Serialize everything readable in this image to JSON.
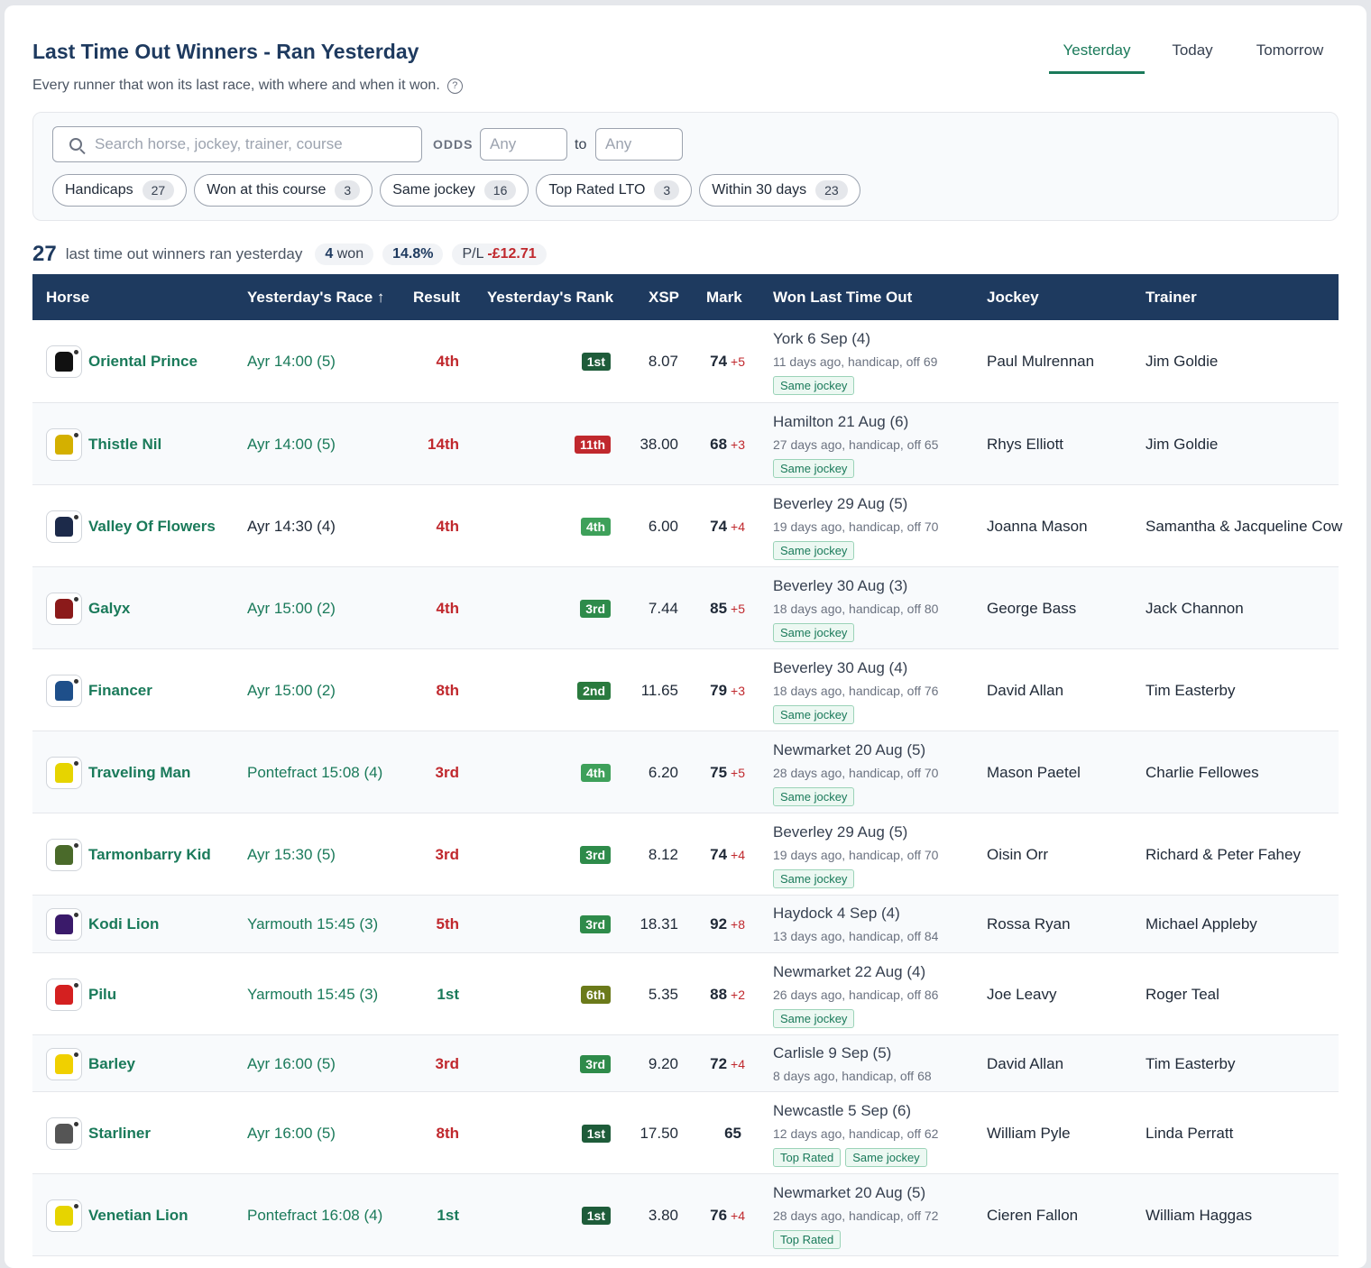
{
  "header": {
    "title": "Last Time Out Winners - Ran Yesterday",
    "subtitle": "Every runner that won its last race, with where and when it won.",
    "help_icon": "?"
  },
  "day_tabs": [
    {
      "label": "Yesterday",
      "active": true
    },
    {
      "label": "Today",
      "active": false
    },
    {
      "label": "Tomorrow",
      "active": false
    }
  ],
  "filters": {
    "search_placeholder": "Search horse, jockey, trainer, course",
    "odds_label": "ODDS",
    "odds_from_placeholder": "Any",
    "odds_to_label": "to",
    "odds_to_placeholder": "Any",
    "chips": [
      {
        "label": "Handicaps",
        "count": "27"
      },
      {
        "label": "Won at this course",
        "count": "3"
      },
      {
        "label": "Same jockey",
        "count": "16"
      },
      {
        "label": "Top Rated LTO",
        "count": "3"
      },
      {
        "label": "Within 30 days",
        "count": "23"
      }
    ]
  },
  "summary": {
    "count": "27",
    "text": "last time out winners ran yesterday",
    "won_count": "4",
    "won_label": "won",
    "strike_rate": "14.8%",
    "pl_label": "P/L",
    "pl_value": "-£12.71"
  },
  "columns": [
    "Horse",
    "Yesterday's Race ↑",
    "Result",
    "Yesterday's Rank",
    "XSP",
    "Mark",
    "Won Last Time Out",
    "Jockey",
    "Trainer"
  ],
  "colors": {
    "accent": "#1a7a5a",
    "header_bg": "#1e3a5f",
    "loss": "#c0282d",
    "win": "#1a7a5a"
  },
  "rows": [
    {
      "horse": "Oriental Prince",
      "race": "Ayr 14:00 (5)",
      "result": "4th",
      "rank": "1st",
      "rank_color": "#1e5c3a",
      "xsp": "8.07",
      "mark": "74",
      "mark_delta": "+5",
      "lto_course": "York 6 Sep (4)",
      "lto_info": "11 days ago, handicap, off 69",
      "tags": [
        "Same jockey"
      ],
      "jockey": "Paul Mulrennan",
      "trainer": "Jim Goldie",
      "silk": "#111111"
    },
    {
      "horse": "Thistle Nil",
      "race": "Ayr 14:00 (5)",
      "result": "14th",
      "rank": "11th",
      "rank_color": "#c0282d",
      "xsp": "38.00",
      "mark": "68",
      "mark_delta": "+3",
      "lto_course": "Hamilton 21 Aug (6)",
      "lto_info": "27 days ago, handicap, off 65",
      "tags": [
        "Same jockey"
      ],
      "jockey": "Rhys Elliott",
      "trainer": "Jim Goldie",
      "silk": "#d4b000"
    },
    {
      "horse": "Valley Of Flowers",
      "race": "Ayr 14:30 (4)",
      "result": "4th",
      "rank": "4th",
      "rank_color": "#3ea05a",
      "xsp": "6.00",
      "mark": "74",
      "mark_delta": "+4",
      "lto_course": "Beverley 29 Aug (5)",
      "lto_info": "19 days ago, handicap, off 70",
      "tags": [
        "Same jockey"
      ],
      "jockey": "Joanna Mason",
      "trainer": "Samantha & Jacqueline Cow",
      "silk": "#1c2a4a"
    },
    {
      "horse": "Galyx",
      "race": "Ayr 15:00 (2)",
      "result": "4th",
      "rank": "3rd",
      "rank_color": "#2e8b4a",
      "xsp": "7.44",
      "mark": "85",
      "mark_delta": "+5",
      "lto_course": "Beverley 30 Aug (3)",
      "lto_info": "18 days ago, handicap, off 80",
      "tags": [
        "Same jockey"
      ],
      "jockey": "George Bass",
      "trainer": "Jack Channon",
      "silk": "#8b1a1a"
    },
    {
      "horse": "Financer",
      "race": "Ayr 15:00 (2)",
      "result": "8th",
      "rank": "2nd",
      "rank_color": "#2a7a3e",
      "xsp": "11.65",
      "mark": "79",
      "mark_delta": "+3",
      "lto_course": "Beverley 30 Aug (4)",
      "lto_info": "18 days ago, handicap, off 76",
      "tags": [
        "Same jockey"
      ],
      "jockey": "David Allan",
      "trainer": "Tim Easterby",
      "silk": "#1e4f8a"
    },
    {
      "horse": "Traveling Man",
      "race": "Pontefract 15:08 (4)",
      "result": "3rd",
      "rank": "4th",
      "rank_color": "#3ea05a",
      "xsp": "6.20",
      "mark": "75",
      "mark_delta": "+5",
      "lto_course": "Newmarket 20 Aug (5)",
      "lto_info": "28 days ago, handicap, off 70",
      "tags": [
        "Same jockey"
      ],
      "jockey": "Mason Paetel",
      "trainer": "Charlie Fellowes",
      "silk": "#e6d400"
    },
    {
      "horse": "Tarmonbarry Kid",
      "race": "Ayr 15:30 (5)",
      "result": "3rd",
      "rank": "3rd",
      "rank_color": "#2e8b4a",
      "xsp": "8.12",
      "mark": "74",
      "mark_delta": "+4",
      "lto_course": "Beverley 29 Aug (5)",
      "lto_info": "19 days ago, handicap, off 70",
      "tags": [
        "Same jockey"
      ],
      "jockey": "Oisin Orr",
      "trainer": "Richard & Peter Fahey",
      "silk": "#4a6a2a"
    },
    {
      "horse": "Kodi Lion",
      "race": "Yarmouth 15:45 (3)",
      "result": "5th",
      "rank": "3rd",
      "rank_color": "#2e8b4a",
      "xsp": "18.31",
      "mark": "92",
      "mark_delta": "+8",
      "lto_course": "Haydock 4 Sep (4)",
      "lto_info": "13 days ago, handicap, off 84",
      "tags": [],
      "jockey": "Rossa Ryan",
      "trainer": "Michael Appleby",
      "silk": "#3a1a6a"
    },
    {
      "horse": "Pilu",
      "race": "Yarmouth 15:45 (3)",
      "result": "1st",
      "rank": "6th",
      "rank_color": "#6b7a1a",
      "xsp": "5.35",
      "mark": "88",
      "mark_delta": "+2",
      "lto_course": "Newmarket 22 Aug (4)",
      "lto_info": "26 days ago, handicap, off 86",
      "tags": [
        "Same jockey"
      ],
      "jockey": "Joe Leavy",
      "trainer": "Roger Teal",
      "silk": "#d42020"
    },
    {
      "horse": "Barley",
      "race": "Ayr 16:00 (5)",
      "result": "3rd",
      "rank": "3rd",
      "rank_color": "#2e8b4a",
      "xsp": "9.20",
      "mark": "72",
      "mark_delta": "+4",
      "lto_course": "Carlisle 9 Sep (5)",
      "lto_info": "8 days ago, handicap, off 68",
      "tags": [],
      "jockey": "David Allan",
      "trainer": "Tim Easterby",
      "silk": "#f0d000"
    },
    {
      "horse": "Starliner",
      "race": "Ayr 16:00 (5)",
      "result": "8th",
      "rank": "1st",
      "rank_color": "#1e5c3a",
      "xsp": "17.50",
      "mark": "65",
      "mark_delta": "",
      "lto_course": "Newcastle 5 Sep (6)",
      "lto_info": "12 days ago, handicap, off 62",
      "tags": [
        "Top Rated",
        "Same jockey"
      ],
      "jockey": "William Pyle",
      "trainer": "Linda Perratt",
      "silk": "#555555"
    },
    {
      "horse": "Venetian Lion",
      "race": "Pontefract 16:08 (4)",
      "result": "1st",
      "rank": "1st",
      "rank_color": "#1e5c3a",
      "xsp": "3.80",
      "mark": "76",
      "mark_delta": "+4",
      "lto_course": "Newmarket 20 Aug (5)",
      "lto_info": "28 days ago, handicap, off 72",
      "tags": [
        "Top Rated"
      ],
      "jockey": "Cieren Fallon",
      "trainer": "William Haggas",
      "silk": "#e6d400"
    }
  ]
}
